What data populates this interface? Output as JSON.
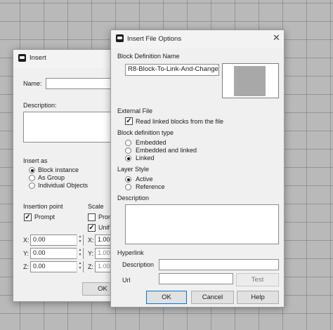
{
  "insert_dialog": {
    "title": "Insert",
    "name_label": "Name:",
    "description_label": "Description:",
    "insert_as_label": "Insert as",
    "insert_as_options": [
      "Block instance",
      "As Group",
      "Individual Objects"
    ],
    "insert_as_selected": 0,
    "insertion_point_label": "Insertion point",
    "prompt_label": "Prompt",
    "scale_label": "Scale",
    "scale_prompt_label": "Prom",
    "uniform_label": "Unif",
    "x_label": "X:",
    "y_label": "Y:",
    "z_label": "Z:",
    "x_value": "0.00",
    "y_value": "0.00",
    "z_value": "0.00",
    "scale_x_label": "X:",
    "scale_y_label": "Y:",
    "scale_z_label": "Z:",
    "scale_x_value": "1.00",
    "scale_y_value": "1.00",
    "scale_z_value": "1.00",
    "ok_label": "OK"
  },
  "options_dialog": {
    "title": "Insert File Options",
    "block_def_name_label": "Block Definition Name",
    "block_def_name_value": "R8-Block-To-Link-And-Change",
    "external_file_label": "External File",
    "read_linked_label": "Read linked blocks from the file",
    "read_linked_checked": true,
    "block_def_type_label": "Block definition type",
    "block_def_types": [
      "Embedded",
      "Embedded and linked",
      "Linked"
    ],
    "block_def_type_selected": 2,
    "layer_style_label": "Layer Style",
    "layer_styles": [
      "Active",
      "Reference"
    ],
    "layer_style_selected": 0,
    "description_label": "Description",
    "hyperlink_label": "Hyperlink",
    "hyperlink_description_label": "Description",
    "url_label": "Url",
    "test_label": "Test",
    "ok_label": "OK",
    "cancel_label": "Cancel",
    "help_label": "Help"
  }
}
